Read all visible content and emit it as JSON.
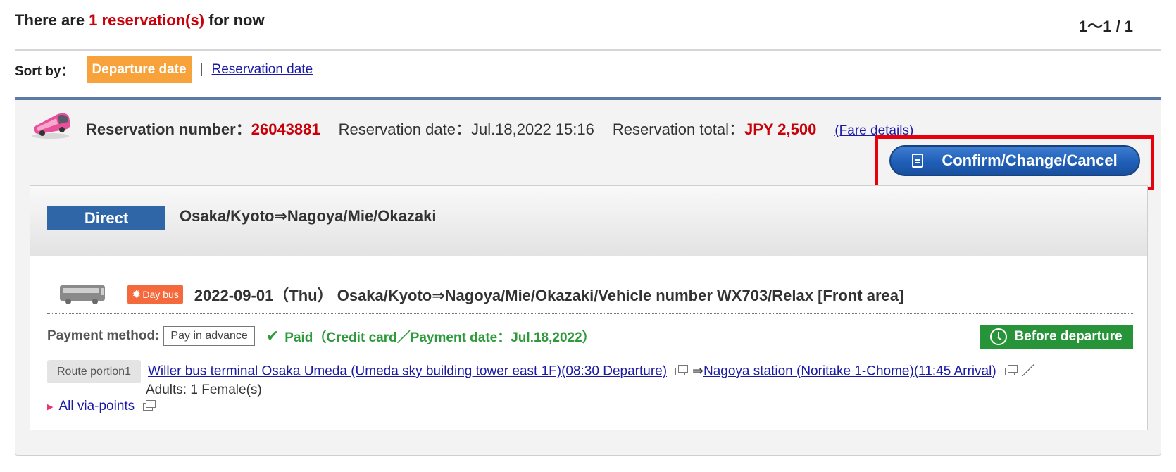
{
  "summary": {
    "prefix": "There are ",
    "count": "1 reservation(s)",
    "suffix": " for now"
  },
  "pager": "1〜1 / 1",
  "sort": {
    "label": "Sort by：",
    "options": [
      {
        "label": "Departure date",
        "active": true
      },
      {
        "label": "Reservation date",
        "active": false
      }
    ],
    "separator": "|"
  },
  "reservation": {
    "number_label": "Reservation number：",
    "number": "26043881",
    "date_label": "Reservation date：",
    "date": "Jul.18,2022 15:16",
    "total_label": "Reservation total：",
    "total": "JPY 2,500",
    "fare_details": "(Fare details)",
    "confirm_button": "Confirm/Change/Cancel",
    "route_type": "Direct",
    "route_title": "Osaka/Kyoto⇒Nagoya/Mie/Okazaki",
    "trip": {
      "badge": "Day bus",
      "text": "2022-09-01（Thu） Osaka/Kyoto⇒Nagoya/Mie/Okazaki/Vehicle number WX703/Relax [Front area]"
    },
    "payment": {
      "label": "Payment method:",
      "method": "Pay in advance",
      "status": "Paid（Credit card／Payment date：Jul.18,2022）"
    },
    "status_badge": "Before departure",
    "route_portion": {
      "label": "Route portion1",
      "departure_link": "Willer bus terminal Osaka Umeda (Umeda sky building tower east 1F)(08:30 Departure)",
      "arrow": "⇒",
      "arrival_link": "Nagoya station (Noritake 1-Chome)(11:45 Arrival)",
      "slash": "／",
      "passengers": "Adults: 1 Female(s)"
    },
    "via_points": "All via-points"
  },
  "colors": {
    "accent_red": "#c8000a",
    "sort_active": "#f7a23a",
    "direct_badge": "#2e66a8",
    "status_green": "#27943a",
    "daybus_orange": "#f56a3c",
    "highlight": "#e8000a"
  }
}
